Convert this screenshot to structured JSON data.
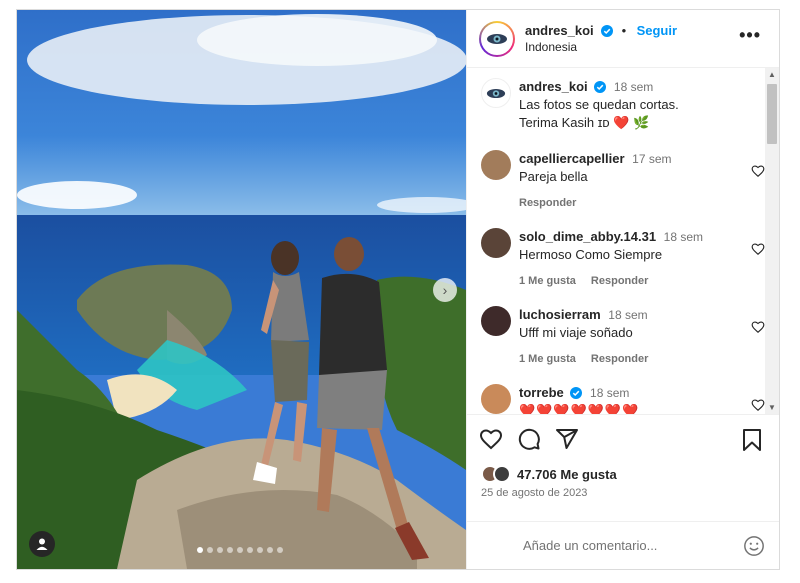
{
  "post": {
    "author": "andres_koi",
    "follow_label": "Seguir",
    "separator": "•",
    "location": "Indonesia",
    "more_label": "•••",
    "carousel": {
      "slide_count": 9,
      "active_index": 0
    }
  },
  "caption": {
    "username": "andres_koi",
    "time": "18 sem",
    "line1": "Las fotos se quedan cortas.",
    "line2": "Terima Kasih ɪᴅ ❤️ 🌿"
  },
  "comments": [
    {
      "username": "capelliercapellier",
      "time": "17 sem",
      "text": "Pareja bella",
      "likes": "",
      "reply": "Responder",
      "verified": false,
      "avatar_color": "#a27c5b"
    },
    {
      "username": "solo_dime_abby.14.31",
      "time": "18 sem",
      "text": "Hermoso Como Siempre",
      "likes": "1 Me gusta",
      "reply": "Responder",
      "verified": false,
      "avatar_color": "#5a4438"
    },
    {
      "username": "luchosierram",
      "time": "18 sem",
      "text": "Ufff mi viaje soñado",
      "likes": "1 Me gusta",
      "reply": "Responder",
      "verified": false,
      "avatar_color": "#3e2a2a"
    },
    {
      "username": "torrebe",
      "time": "18 sem",
      "text": "❤️❤️❤️❤️❤️❤️❤️",
      "likes": "",
      "reply": "",
      "verified": true,
      "avatar_color": "#c98a5a"
    }
  ],
  "stats": {
    "likes": "47.706 Me gusta",
    "date": "25 de agosto de 2023"
  },
  "composer": {
    "placeholder": "Añade un comentario..."
  },
  "icons": {
    "like": "heart-icon",
    "comment": "comment-icon",
    "share": "share-icon",
    "save": "bookmark-icon",
    "emoji": "emoji-icon",
    "verified": "verified-badge-icon",
    "user_tag": "user-tag-icon",
    "next": "chevron-right-icon"
  },
  "colors": {
    "accent": "#0095f6",
    "text": "#262626",
    "muted": "#737373",
    "heart_red": "#ed4956"
  }
}
